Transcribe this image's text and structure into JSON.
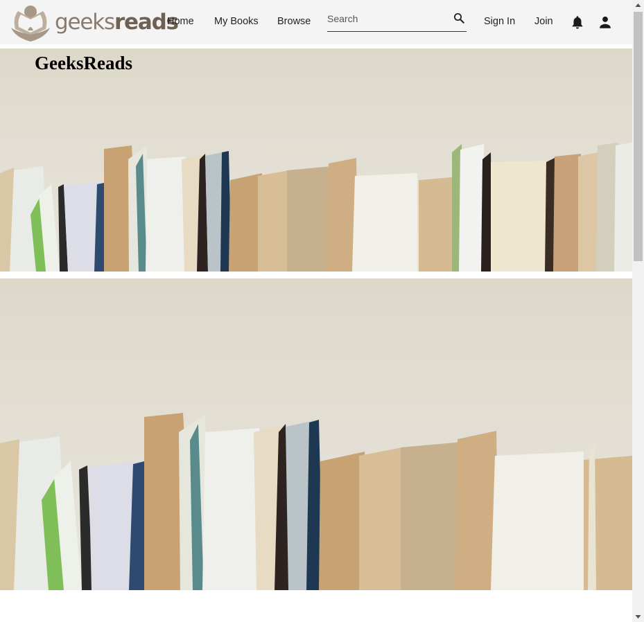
{
  "brand": {
    "logo_text_light": "geeks",
    "logo_text_bold": "reads",
    "site_title": "GeeksReads"
  },
  "nav": {
    "home": "Home",
    "my_books": "My Books",
    "browse": "Browse",
    "sign_in": "Sign In",
    "join": "Join"
  },
  "search": {
    "placeholder": "Search",
    "value": ""
  },
  "icons": {
    "search": "search-icon",
    "notifications": "bell-icon",
    "account": "person-icon",
    "logo": "book-reader-logo-icon"
  },
  "colors": {
    "navbar_bg": "#f4f4f4",
    "logo_brown": "#8a7a6c",
    "wall": "#e3dfd3",
    "text": "#222222"
  }
}
